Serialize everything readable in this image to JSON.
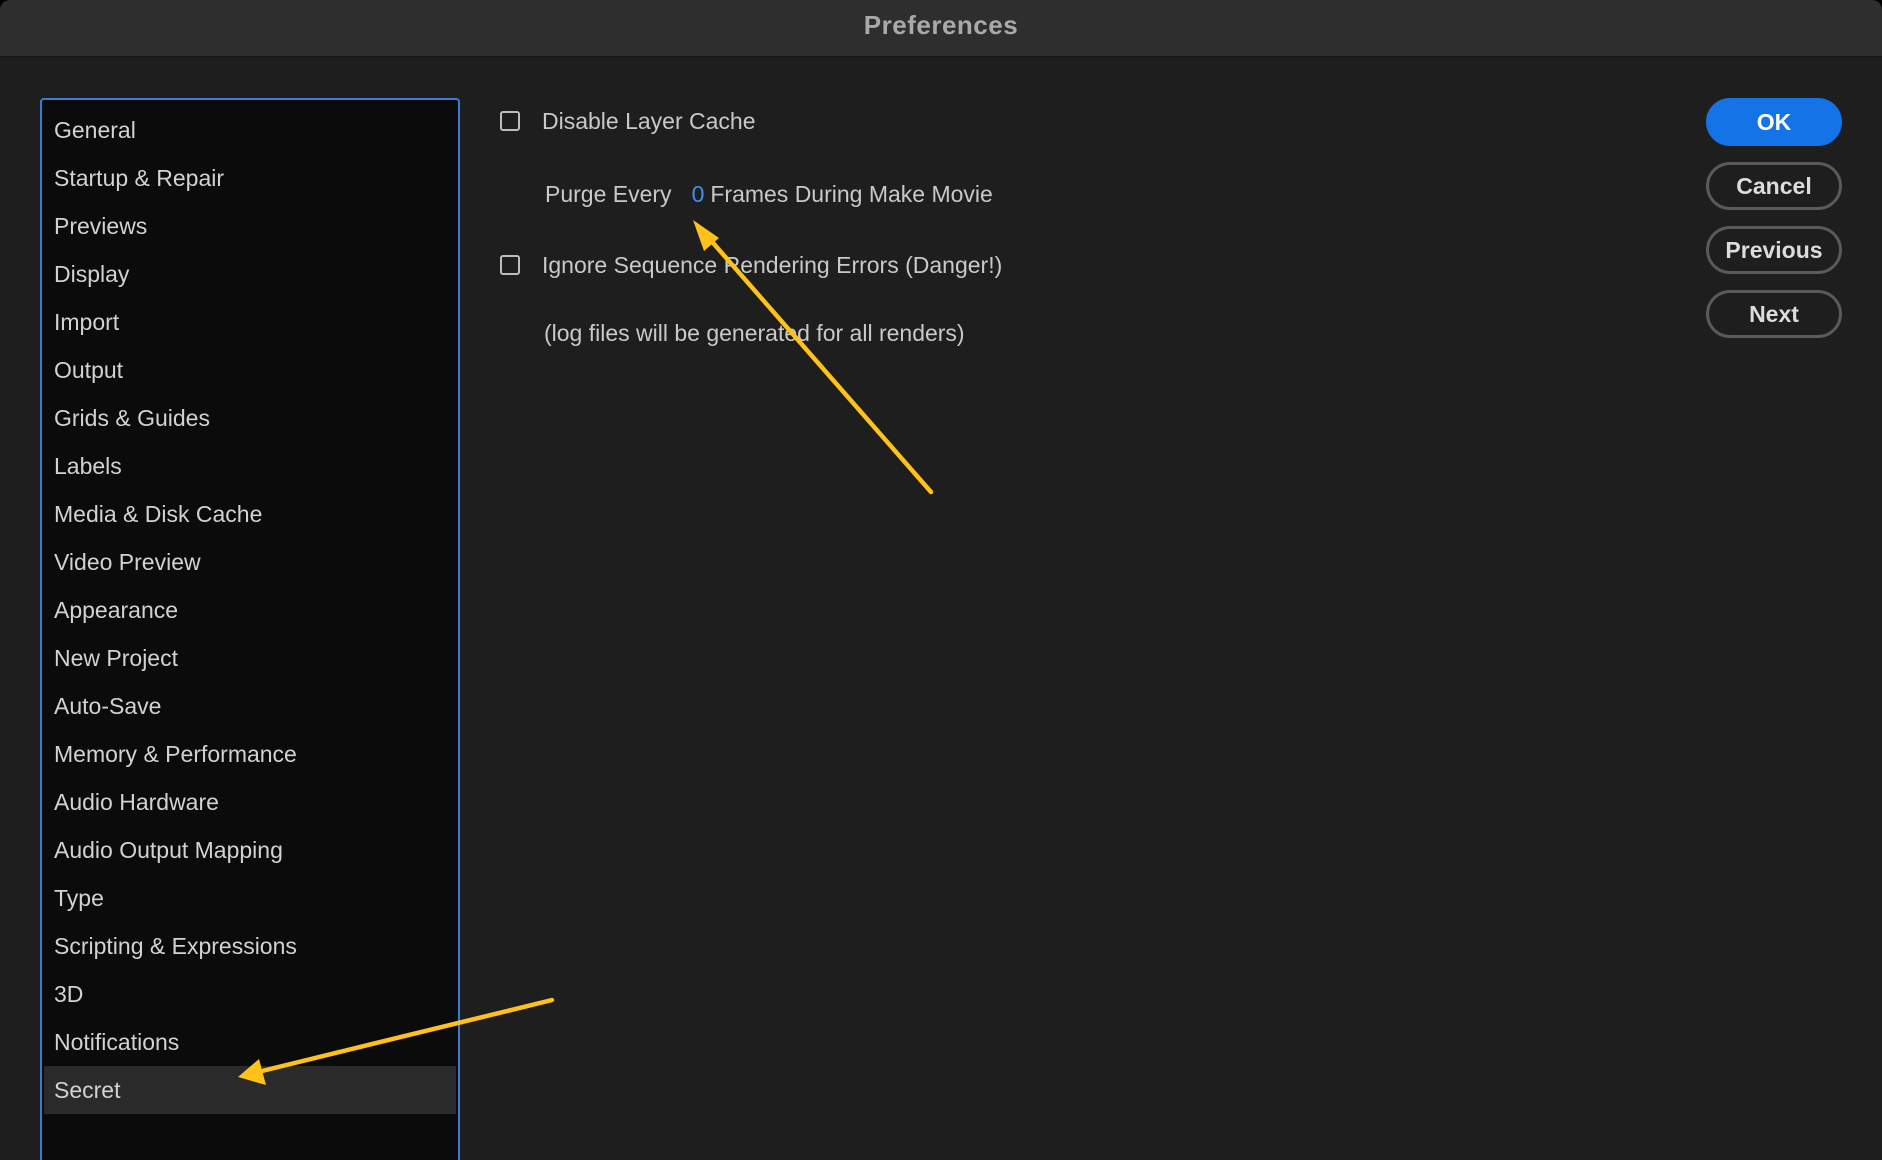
{
  "window": {
    "title": "Preferences"
  },
  "sidebar": {
    "items": [
      {
        "label": "General"
      },
      {
        "label": "Startup & Repair"
      },
      {
        "label": "Previews"
      },
      {
        "label": "Display"
      },
      {
        "label": "Import"
      },
      {
        "label": "Output"
      },
      {
        "label": "Grids & Guides"
      },
      {
        "label": "Labels"
      },
      {
        "label": "Media & Disk Cache"
      },
      {
        "label": "Video Preview"
      },
      {
        "label": "Appearance"
      },
      {
        "label": "New Project"
      },
      {
        "label": "Auto-Save"
      },
      {
        "label": "Memory & Performance"
      },
      {
        "label": "Audio Hardware"
      },
      {
        "label": "Audio Output Mapping"
      },
      {
        "label": "Type"
      },
      {
        "label": "Scripting & Expressions"
      },
      {
        "label": "3D"
      },
      {
        "label": "Notifications"
      },
      {
        "label": "Secret",
        "selected": true
      }
    ]
  },
  "settings": {
    "disable_layer_cache": {
      "label": "Disable Layer Cache",
      "checked": false
    },
    "purge": {
      "prefix": "Purge Every",
      "value": "0",
      "suffix": "Frames During Make Movie"
    },
    "ignore_errors": {
      "label": "Ignore Sequence Rendering Errors (Danger!)",
      "checked": false
    },
    "log_note": "(log files will be generated for all renders)"
  },
  "buttons": {
    "ok": "OK",
    "cancel": "Cancel",
    "previous": "Previous",
    "next": "Next"
  },
  "colors": {
    "accent": "#1473e6",
    "annotation_arrow": "#ffc21a",
    "sidebar_border": "#3b7bd4"
  }
}
